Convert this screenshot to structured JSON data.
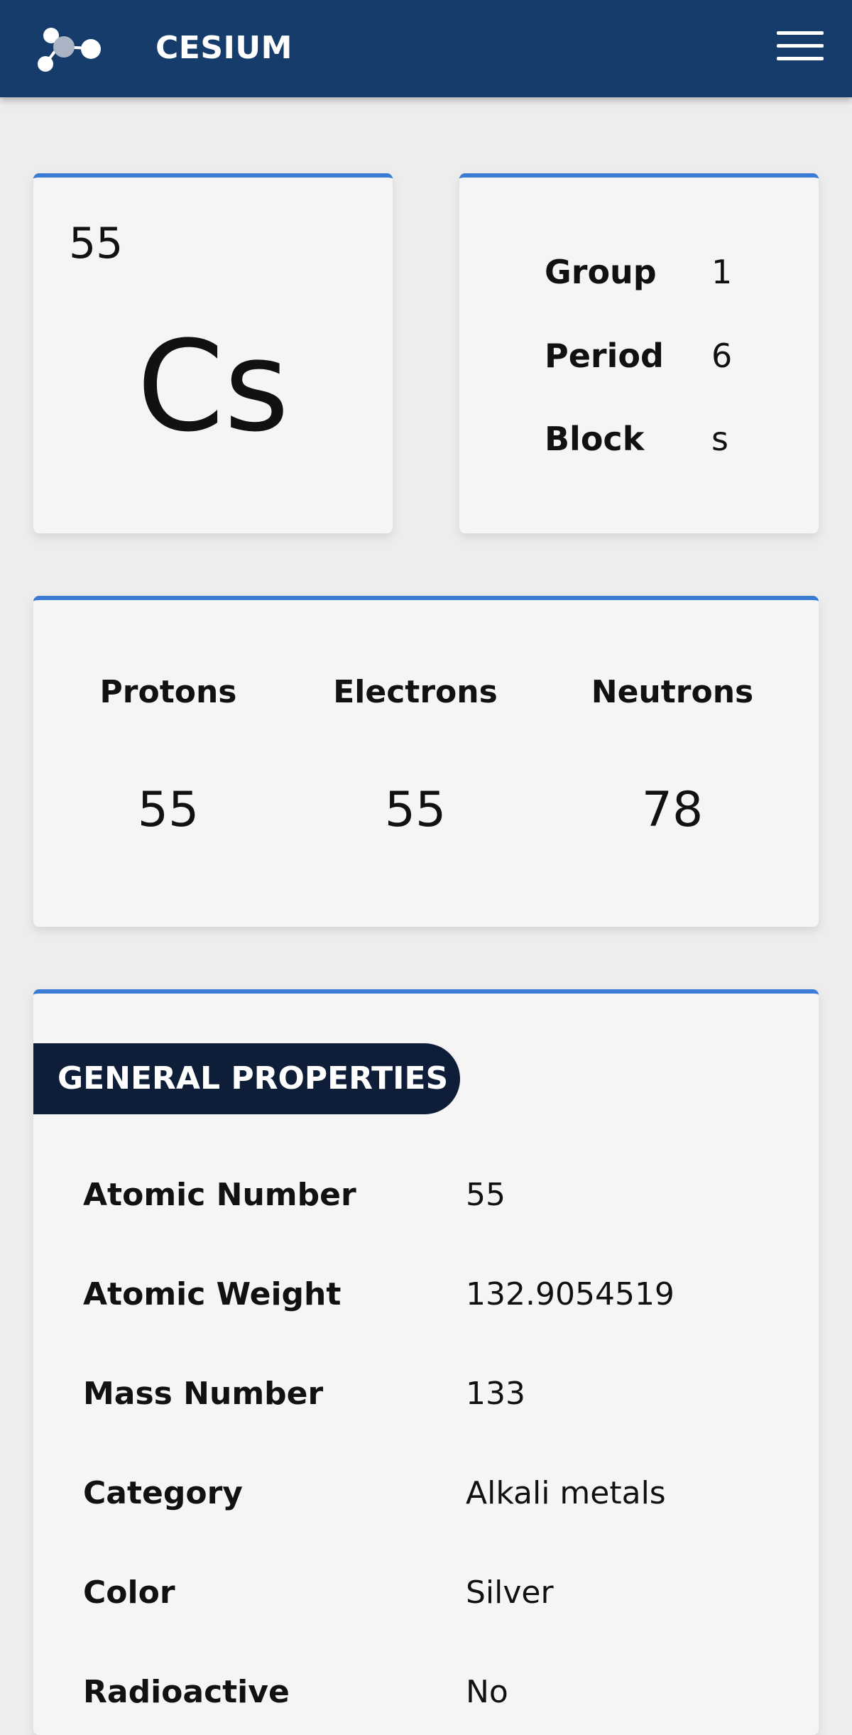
{
  "header": {
    "title": "CESIUM",
    "logo_icon": "molecule-logo-icon",
    "menu_icon": "hamburger-menu-icon",
    "background_color": "#153c6b"
  },
  "element": {
    "atomic_number": "55",
    "symbol": "Cs"
  },
  "position": {
    "rows": [
      {
        "label": "Group",
        "value": "1"
      },
      {
        "label": "Period",
        "value": "6"
      },
      {
        "label": "Block",
        "value": "s"
      }
    ]
  },
  "particles": [
    {
      "label": "Protons",
      "value": "55"
    },
    {
      "label": "Electrons",
      "value": "55"
    },
    {
      "label": "Neutrons",
      "value": "78"
    }
  ],
  "general": {
    "heading": "GENERAL PROPERTIES",
    "rows": [
      {
        "label": "Atomic Number",
        "value": "55"
      },
      {
        "label": "Atomic Weight",
        "value": "132.9054519"
      },
      {
        "label": "Mass Number",
        "value": "133"
      },
      {
        "label": "Category",
        "value": "Alkali metals"
      },
      {
        "label": "Color",
        "value": "Silver"
      },
      {
        "label": "Radioactive",
        "value": "No"
      }
    ]
  },
  "colors": {
    "accent": "#3a7bd5",
    "section_heading_bg": "#0e1e38",
    "card_bg": "#f5f5f5",
    "page_bg": "#ededed"
  }
}
